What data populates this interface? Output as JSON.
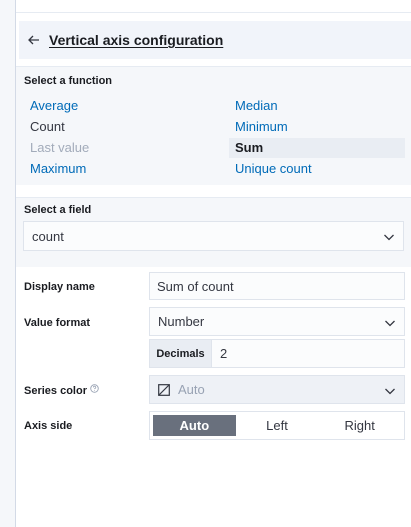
{
  "header": {
    "title": "Vertical axis configuration"
  },
  "function_section": {
    "label": "Select a function",
    "functions": [
      {
        "label": "Average",
        "state": "link"
      },
      {
        "label": "Median",
        "state": "link"
      },
      {
        "label": "Count",
        "state": "plain"
      },
      {
        "label": "Minimum",
        "state": "link"
      },
      {
        "label": "Last value",
        "state": "disabled"
      },
      {
        "label": "Sum",
        "state": "selected"
      },
      {
        "label": "Maximum",
        "state": "link"
      },
      {
        "label": "Unique count",
        "state": "link"
      }
    ]
  },
  "field_section": {
    "label": "Select a field",
    "value": "count"
  },
  "display_name": {
    "label": "Display name",
    "value": "Sum of count"
  },
  "value_format": {
    "label": "Value format",
    "value": "Number"
  },
  "decimals": {
    "label": "Decimals",
    "value": "2"
  },
  "series_color": {
    "label": "Series color",
    "value": "Auto"
  },
  "axis_side": {
    "label": "Axis side",
    "options": [
      "Auto",
      "Left",
      "Right"
    ],
    "selected": "Auto"
  },
  "colors": {
    "accent": "#006bb8",
    "selected_segment": "#69707d",
    "section_bg": "#f5f7fa"
  },
  "icons": {
    "back": "arrow-left-icon",
    "chevron": "chevron-down-icon",
    "swatch": "color-swatch-icon",
    "help": "question-circle-icon"
  }
}
